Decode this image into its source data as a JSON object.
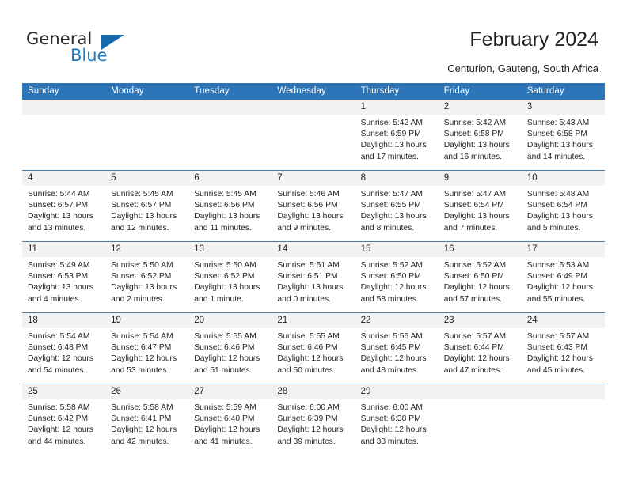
{
  "brand": {
    "name_part1": "General",
    "name_part2": "Blue",
    "triangle_color": "#1668ad",
    "blue_color": "#1f7ac0"
  },
  "header": {
    "title": "February 2024",
    "subtitle": "Centurion, Gauteng, South Africa"
  },
  "calendar": {
    "header_bg": "#2b75b8",
    "daynum_bg": "#f2f2f2",
    "weekdays": [
      "Sunday",
      "Monday",
      "Tuesday",
      "Wednesday",
      "Thursday",
      "Friday",
      "Saturday"
    ],
    "weeks": [
      [
        {
          "day": "",
          "empty": true,
          "sunrise": "",
          "sunset": "",
          "daylight1": "",
          "daylight2": ""
        },
        {
          "day": "",
          "empty": true,
          "sunrise": "",
          "sunset": "",
          "daylight1": "",
          "daylight2": ""
        },
        {
          "day": "",
          "empty": true,
          "sunrise": "",
          "sunset": "",
          "daylight1": "",
          "daylight2": ""
        },
        {
          "day": "",
          "empty": true,
          "sunrise": "",
          "sunset": "",
          "daylight1": "",
          "daylight2": ""
        },
        {
          "day": "1",
          "sunrise": "Sunrise: 5:42 AM",
          "sunset": "Sunset: 6:59 PM",
          "daylight1": "Daylight: 13 hours",
          "daylight2": "and 17 minutes."
        },
        {
          "day": "2",
          "sunrise": "Sunrise: 5:42 AM",
          "sunset": "Sunset: 6:58 PM",
          "daylight1": "Daylight: 13 hours",
          "daylight2": "and 16 minutes."
        },
        {
          "day": "3",
          "sunrise": "Sunrise: 5:43 AM",
          "sunset": "Sunset: 6:58 PM",
          "daylight1": "Daylight: 13 hours",
          "daylight2": "and 14 minutes."
        }
      ],
      [
        {
          "day": "4",
          "sunrise": "Sunrise: 5:44 AM",
          "sunset": "Sunset: 6:57 PM",
          "daylight1": "Daylight: 13 hours",
          "daylight2": "and 13 minutes."
        },
        {
          "day": "5",
          "sunrise": "Sunrise: 5:45 AM",
          "sunset": "Sunset: 6:57 PM",
          "daylight1": "Daylight: 13 hours",
          "daylight2": "and 12 minutes."
        },
        {
          "day": "6",
          "sunrise": "Sunrise: 5:45 AM",
          "sunset": "Sunset: 6:56 PM",
          "daylight1": "Daylight: 13 hours",
          "daylight2": "and 11 minutes."
        },
        {
          "day": "7",
          "sunrise": "Sunrise: 5:46 AM",
          "sunset": "Sunset: 6:56 PM",
          "daylight1": "Daylight: 13 hours",
          "daylight2": "and 9 minutes."
        },
        {
          "day": "8",
          "sunrise": "Sunrise: 5:47 AM",
          "sunset": "Sunset: 6:55 PM",
          "daylight1": "Daylight: 13 hours",
          "daylight2": "and 8 minutes."
        },
        {
          "day": "9",
          "sunrise": "Sunrise: 5:47 AM",
          "sunset": "Sunset: 6:54 PM",
          "daylight1": "Daylight: 13 hours",
          "daylight2": "and 7 minutes."
        },
        {
          "day": "10",
          "sunrise": "Sunrise: 5:48 AM",
          "sunset": "Sunset: 6:54 PM",
          "daylight1": "Daylight: 13 hours",
          "daylight2": "and 5 minutes."
        }
      ],
      [
        {
          "day": "11",
          "sunrise": "Sunrise: 5:49 AM",
          "sunset": "Sunset: 6:53 PM",
          "daylight1": "Daylight: 13 hours",
          "daylight2": "and 4 minutes."
        },
        {
          "day": "12",
          "sunrise": "Sunrise: 5:50 AM",
          "sunset": "Sunset: 6:52 PM",
          "daylight1": "Daylight: 13 hours",
          "daylight2": "and 2 minutes."
        },
        {
          "day": "13",
          "sunrise": "Sunrise: 5:50 AM",
          "sunset": "Sunset: 6:52 PM",
          "daylight1": "Daylight: 13 hours",
          "daylight2": "and 1 minute."
        },
        {
          "day": "14",
          "sunrise": "Sunrise: 5:51 AM",
          "sunset": "Sunset: 6:51 PM",
          "daylight1": "Daylight: 13 hours",
          "daylight2": "and 0 minutes."
        },
        {
          "day": "15",
          "sunrise": "Sunrise: 5:52 AM",
          "sunset": "Sunset: 6:50 PM",
          "daylight1": "Daylight: 12 hours",
          "daylight2": "and 58 minutes."
        },
        {
          "day": "16",
          "sunrise": "Sunrise: 5:52 AM",
          "sunset": "Sunset: 6:50 PM",
          "daylight1": "Daylight: 12 hours",
          "daylight2": "and 57 minutes."
        },
        {
          "day": "17",
          "sunrise": "Sunrise: 5:53 AM",
          "sunset": "Sunset: 6:49 PM",
          "daylight1": "Daylight: 12 hours",
          "daylight2": "and 55 minutes."
        }
      ],
      [
        {
          "day": "18",
          "sunrise": "Sunrise: 5:54 AM",
          "sunset": "Sunset: 6:48 PM",
          "daylight1": "Daylight: 12 hours",
          "daylight2": "and 54 minutes."
        },
        {
          "day": "19",
          "sunrise": "Sunrise: 5:54 AM",
          "sunset": "Sunset: 6:47 PM",
          "daylight1": "Daylight: 12 hours",
          "daylight2": "and 53 minutes."
        },
        {
          "day": "20",
          "sunrise": "Sunrise: 5:55 AM",
          "sunset": "Sunset: 6:46 PM",
          "daylight1": "Daylight: 12 hours",
          "daylight2": "and 51 minutes."
        },
        {
          "day": "21",
          "sunrise": "Sunrise: 5:55 AM",
          "sunset": "Sunset: 6:46 PM",
          "daylight1": "Daylight: 12 hours",
          "daylight2": "and 50 minutes."
        },
        {
          "day": "22",
          "sunrise": "Sunrise: 5:56 AM",
          "sunset": "Sunset: 6:45 PM",
          "daylight1": "Daylight: 12 hours",
          "daylight2": "and 48 minutes."
        },
        {
          "day": "23",
          "sunrise": "Sunrise: 5:57 AM",
          "sunset": "Sunset: 6:44 PM",
          "daylight1": "Daylight: 12 hours",
          "daylight2": "and 47 minutes."
        },
        {
          "day": "24",
          "sunrise": "Sunrise: 5:57 AM",
          "sunset": "Sunset: 6:43 PM",
          "daylight1": "Daylight: 12 hours",
          "daylight2": "and 45 minutes."
        }
      ],
      [
        {
          "day": "25",
          "sunrise": "Sunrise: 5:58 AM",
          "sunset": "Sunset: 6:42 PM",
          "daylight1": "Daylight: 12 hours",
          "daylight2": "and 44 minutes."
        },
        {
          "day": "26",
          "sunrise": "Sunrise: 5:58 AM",
          "sunset": "Sunset: 6:41 PM",
          "daylight1": "Daylight: 12 hours",
          "daylight2": "and 42 minutes."
        },
        {
          "day": "27",
          "sunrise": "Sunrise: 5:59 AM",
          "sunset": "Sunset: 6:40 PM",
          "daylight1": "Daylight: 12 hours",
          "daylight2": "and 41 minutes."
        },
        {
          "day": "28",
          "sunrise": "Sunrise: 6:00 AM",
          "sunset": "Sunset: 6:39 PM",
          "daylight1": "Daylight: 12 hours",
          "daylight2": "and 39 minutes."
        },
        {
          "day": "29",
          "sunrise": "Sunrise: 6:00 AM",
          "sunset": "Sunset: 6:38 PM",
          "daylight1": "Daylight: 12 hours",
          "daylight2": "and 38 minutes."
        },
        {
          "day": "",
          "empty": true,
          "sunrise": "",
          "sunset": "",
          "daylight1": "",
          "daylight2": ""
        },
        {
          "day": "",
          "empty": true,
          "sunrise": "",
          "sunset": "",
          "daylight1": "",
          "daylight2": ""
        }
      ]
    ]
  }
}
